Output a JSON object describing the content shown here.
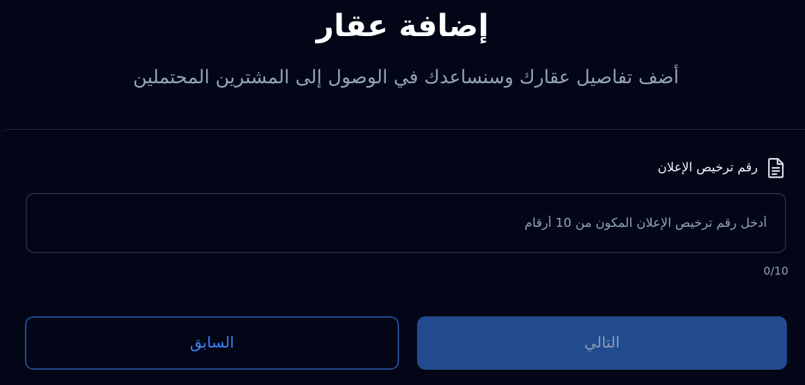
{
  "header": {
    "title": "إضافة عقار",
    "subtitle": "أضف تفاصيل عقارك وسنساعدك في الوصول إلى المشترين المحتملين"
  },
  "form": {
    "license_field": {
      "label": "رقم ترخيص الإعلان",
      "icon": "document-icon",
      "placeholder": "أدخل رقم ترخيص الإعلان المكون من 10 أرقام",
      "value": "",
      "counter": "0/10"
    }
  },
  "actions": {
    "next_label": "التالي",
    "prev_label": "السابق"
  },
  "colors": {
    "background": "#020617",
    "primary_button": "#224b8f",
    "outline_button_border": "#234d96",
    "outline_button_text": "#3b82f6",
    "muted_text": "#94a3b8"
  }
}
